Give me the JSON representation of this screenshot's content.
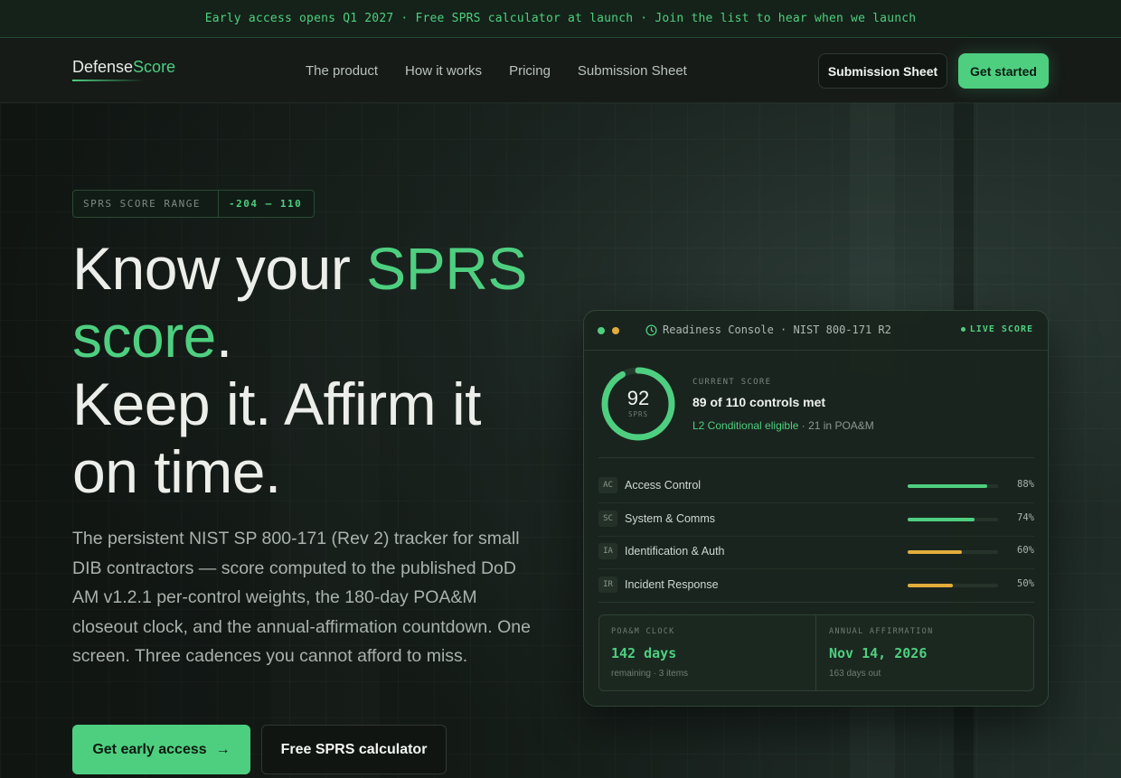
{
  "announcement": "Early access opens Q1 2027 · Free SPRS calculator at launch · Join the list to hear when we launch",
  "nav": {
    "logo_main": "Defense",
    "logo_accent": "Score",
    "links": [
      "The product",
      "How it works",
      "Pricing",
      "Submission Sheet"
    ],
    "submission_button": "Submission Sheet",
    "get_started_button": "Get started"
  },
  "hero": {
    "chip_label": "SPRS SCORE RANGE",
    "chip_value": "-204 – 110",
    "headline": {
      "l1a": "Know your ",
      "l1b": "SPRS",
      "l2a": "score",
      "l2b": ".",
      "l3": "Keep it. Affirm it",
      "l4": "on time."
    },
    "subcopy": "The persistent NIST SP 800-171 (Rev 2) tracker for small DIB contractors — score computed to the published DoD AM v1.2.1 per-control weights, the 180-day POA&M closeout clock, and the annual-affirmation countdown. One screen. Three cadences you cannot afford to miss.",
    "cta_primary": "Get early access",
    "cta_primary_arrow": "→",
    "cta_secondary": "Free SPRS calculator"
  },
  "console": {
    "title": "Readiness Console · NIST 800-171 R2",
    "live": "LIVE SCORE",
    "score": "92",
    "score_label": "SPRS",
    "score_fraction": 0.92,
    "current_label": "CURRENT SCORE",
    "current_value": "89 of 110 controls met",
    "eligibility": "L2 Conditional eligible",
    "poam_note": " · 21 in POA&M",
    "colors": {
      "green": "#4ecf80",
      "amber": "#e2ad3b",
      "dot_green": "#4ecf80",
      "dot_amber": "#e2ad3b"
    },
    "controls": [
      {
        "tag": "AC",
        "name": "Access Control",
        "percent": 88,
        "pct_label": "88%",
        "color": "#4ecf80"
      },
      {
        "tag": "SC",
        "name": "System & Comms",
        "percent": 74,
        "pct_label": "74%",
        "color": "#4ecf80"
      },
      {
        "tag": "IA",
        "name": "Identification & Auth",
        "percent": 60,
        "pct_label": "60%",
        "color": "#e2ad3b"
      },
      {
        "tag": "IR",
        "name": "Incident Response",
        "percent": 50,
        "pct_label": "50%",
        "color": "#e2ad3b"
      }
    ],
    "poam": {
      "label": "POA&M CLOCK",
      "value": "142 days",
      "sub": "remaining · 3 items"
    },
    "affirmation": {
      "label": "ANNUAL AFFIRMATION",
      "value": "Nov 14, 2026",
      "sub": "163 days out"
    }
  }
}
